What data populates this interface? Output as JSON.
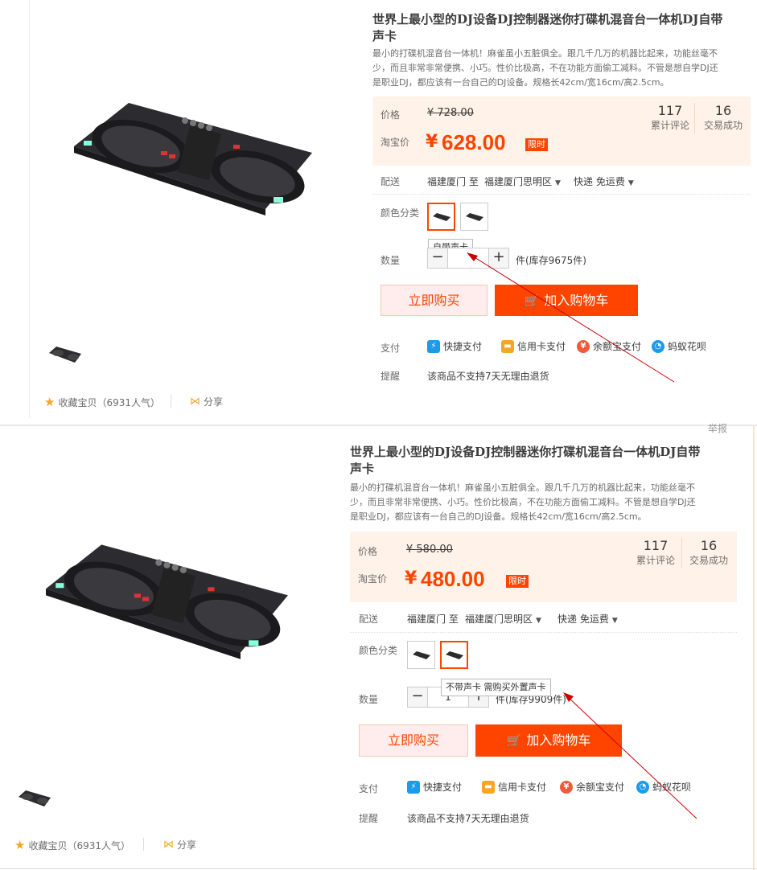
{
  "panel1": {
    "title": "世界上最小型的DJ设备DJ控制器迷你打碟机混音台一体机DJ自带声卡",
    "title_line1": "世界上最小型的DJ设备DJ控制器迷你打碟机混音台一体机DJ自带",
    "title_line2": "声卡",
    "desc_line1": "最小的打碟机混音台一体机！麻雀虽小五脏俱全。跟几千几万的机器比起来，功能丝毫不",
    "desc_line2": "少，而且非常非常便携、小巧。性价比极高，不在功能方面偷工减料。不管是想自学DJ还",
    "desc_line3": "是职业DJ，都应该有一台自己的DJ设备。规格长42cm/宽16cm/高2.5cm。",
    "price_label": "价格",
    "old_price": "¥ 728.00",
    "taobao_label": "淘宝价",
    "currency": "¥",
    "price": "628.00",
    "limit_tag": "限时",
    "reviews_count": "117",
    "reviews_label": "累计评论",
    "deals_count": "16",
    "deals_label": "交易成功",
    "delivery_label": "配送",
    "delivery_from": "福建厦门 至",
    "delivery_to": "福建厦门思明区",
    "delivery_method": "快递 免运费",
    "color_label": "颜色分类",
    "tooltip": "自带声卡",
    "qty_label": "数量",
    "qty_minus": "−",
    "qty_plus": "+",
    "stock": "件(库存9675件)",
    "buy_now": "立即购买",
    "add_cart": "加入购物车",
    "pay_label": "支付",
    "pay_methods": [
      "快捷支付",
      "信用卡支付",
      "余额宝支付",
      "蚂蚁花呗"
    ],
    "remind_label": "提醒",
    "remind_text": "该商品不支持7天无理由退货",
    "fav": "收藏宝贝（6931人气）",
    "share": "分享"
  },
  "panel2": {
    "report": "举报",
    "title_line1": "世界上最小型的DJ设备DJ控制器迷你打碟机混音台一体机DJ自带",
    "title_line2": "声卡",
    "desc_line1": "最小的打碟机混音台一体机！麻雀虽小五脏俱全。跟几千几万的机器比起来，功能丝毫不",
    "desc_line2": "少，而且非常非常便携、小巧。性价比极高，不在功能方面偷工减料。不管是想自学DJ还",
    "desc_line3": "是职业DJ，都应该有一台自己的DJ设备。规格长42cm/宽16cm/高2.5cm。",
    "price_label": "价格",
    "old_price": "¥ 580.00",
    "taobao_label": "淘宝价",
    "currency": "¥",
    "price": "480.00",
    "limit_tag": "限时",
    "reviews_count": "117",
    "reviews_label": "累计评论",
    "deals_count": "16",
    "deals_label": "交易成功",
    "delivery_label": "配送",
    "delivery_from": "福建厦门 至",
    "delivery_to": "福建厦门思明区",
    "delivery_method": "快递 免运费",
    "color_label": "颜色分类",
    "tooltip": "不带声卡 需购买外置声卡",
    "qty_label": "数量",
    "qty_minus": "−",
    "qty_value": "1",
    "qty_plus": "+",
    "stock": "件(库存9909件)",
    "buy_now": "立即购买",
    "add_cart": "加入购物车",
    "pay_label": "支付",
    "pay_methods": [
      "快捷支付",
      "信用卡支付",
      "余额宝支付",
      "蚂蚁花呗"
    ],
    "remind_label": "提醒",
    "remind_text": "该商品不支持7天无理由退货",
    "fav": "收藏宝贝（6931人气）",
    "share": "分享"
  },
  "colors": {
    "accent": "#ff4400",
    "price_bg": "#fff2e8",
    "annotation_arrow": "#cc0000"
  }
}
